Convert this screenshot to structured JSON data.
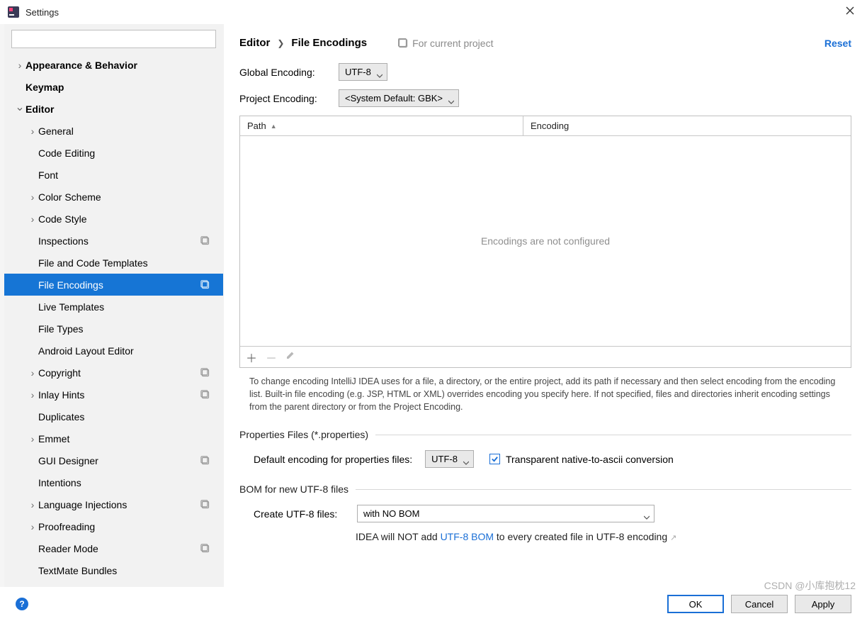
{
  "window": {
    "title": "Settings"
  },
  "search": {
    "placeholder": ""
  },
  "sidebar": {
    "items": [
      {
        "label": "Appearance & Behavior",
        "bold": true,
        "chev": "right",
        "lvl": 1,
        "proj": false
      },
      {
        "label": "Keymap",
        "bold": true,
        "chev": "none",
        "lvl": 1,
        "proj": false
      },
      {
        "label": "Editor",
        "bold": true,
        "chev": "down",
        "lvl": 1,
        "proj": false
      },
      {
        "label": "General",
        "bold": false,
        "chev": "right",
        "lvl": 2,
        "proj": false
      },
      {
        "label": "Code Editing",
        "bold": false,
        "chev": "none",
        "lvl": 2,
        "proj": false
      },
      {
        "label": "Font",
        "bold": false,
        "chev": "none",
        "lvl": 2,
        "proj": false
      },
      {
        "label": "Color Scheme",
        "bold": false,
        "chev": "right",
        "lvl": 2,
        "proj": false
      },
      {
        "label": "Code Style",
        "bold": false,
        "chev": "right",
        "lvl": 2,
        "proj": false
      },
      {
        "label": "Inspections",
        "bold": false,
        "chev": "none",
        "lvl": 2,
        "proj": true
      },
      {
        "label": "File and Code Templates",
        "bold": false,
        "chev": "none",
        "lvl": 2,
        "proj": false
      },
      {
        "label": "File Encodings",
        "bold": false,
        "chev": "none",
        "lvl": 2,
        "proj": true,
        "selected": true
      },
      {
        "label": "Live Templates",
        "bold": false,
        "chev": "none",
        "lvl": 2,
        "proj": false
      },
      {
        "label": "File Types",
        "bold": false,
        "chev": "none",
        "lvl": 2,
        "proj": false
      },
      {
        "label": "Android Layout Editor",
        "bold": false,
        "chev": "none",
        "lvl": 2,
        "proj": false
      },
      {
        "label": "Copyright",
        "bold": false,
        "chev": "right",
        "lvl": 2,
        "proj": true
      },
      {
        "label": "Inlay Hints",
        "bold": false,
        "chev": "right",
        "lvl": 2,
        "proj": true
      },
      {
        "label": "Duplicates",
        "bold": false,
        "chev": "none",
        "lvl": 2,
        "proj": false
      },
      {
        "label": "Emmet",
        "bold": false,
        "chev": "right",
        "lvl": 2,
        "proj": false
      },
      {
        "label": "GUI Designer",
        "bold": false,
        "chev": "none",
        "lvl": 2,
        "proj": true
      },
      {
        "label": "Intentions",
        "bold": false,
        "chev": "none",
        "lvl": 2,
        "proj": false
      },
      {
        "label": "Language Injections",
        "bold": false,
        "chev": "right",
        "lvl": 2,
        "proj": true
      },
      {
        "label": "Proofreading",
        "bold": false,
        "chev": "right",
        "lvl": 2,
        "proj": false
      },
      {
        "label": "Reader Mode",
        "bold": false,
        "chev": "none",
        "lvl": 2,
        "proj": true
      },
      {
        "label": "TextMate Bundles",
        "bold": false,
        "chev": "none",
        "lvl": 2,
        "proj": false
      }
    ]
  },
  "breadcrumb": {
    "a": "Editor",
    "b": "File Encodings",
    "fcp": "For current project",
    "reset": "Reset"
  },
  "global": {
    "label": "Global Encoding:",
    "value": "UTF-8"
  },
  "project": {
    "label": "Project Encoding:",
    "value": "<System Default: GBK>"
  },
  "table": {
    "col_path": "Path",
    "col_enc": "Encoding",
    "empty_msg": "Encodings are not configured"
  },
  "description": "To change encoding IntelliJ IDEA uses for a file, a directory, or the entire project, add its path if necessary and then select encoding from the encoding list. Built-in file encoding (e.g. JSP, HTML or XML) overrides encoding you specify here. If not specified, files and directories inherit encoding settings from the parent directory or from the Project Encoding.",
  "props": {
    "header": "Properties Files (*.properties)",
    "label": "Default encoding for properties files:",
    "value": "UTF-8",
    "check_label": "Transparent native-to-ascii conversion",
    "checked": true
  },
  "bom": {
    "header": "BOM for new UTF-8 files",
    "label": "Create UTF-8 files:",
    "value": "with NO BOM",
    "info_pre": "IDEA will NOT add ",
    "info_link": "UTF-8 BOM",
    "info_post": " to every created file in UTF-8 encoding"
  },
  "footer": {
    "ok": "OK",
    "cancel": "Cancel",
    "apply": "Apply"
  },
  "watermark": "CSDN @小库抱枕12"
}
